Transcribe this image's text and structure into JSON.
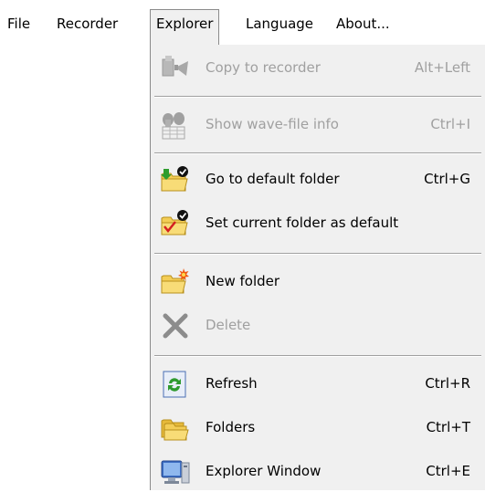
{
  "menubar": {
    "items": [
      {
        "label": "File"
      },
      {
        "label": "Recorder"
      },
      {
        "label": "Explorer"
      },
      {
        "label": "Language"
      },
      {
        "label": "About..."
      }
    ]
  },
  "explorer_menu": {
    "items": [
      {
        "label": "Copy to recorder",
        "shortcut": "Alt+Left",
        "enabled": false,
        "icon": "copy-to-recorder-icon"
      },
      {
        "label": "Show wave-file info",
        "shortcut": "Ctrl+I",
        "enabled": false,
        "icon": "wave-info-icon"
      },
      {
        "label": "Go to default folder",
        "shortcut": "Ctrl+G",
        "enabled": true,
        "icon": "default-folder-icon"
      },
      {
        "label": "Set current folder as default",
        "shortcut": "",
        "enabled": true,
        "icon": "set-default-folder-icon"
      },
      {
        "label": "New folder",
        "shortcut": "",
        "enabled": true,
        "icon": "new-folder-icon"
      },
      {
        "label": "Delete",
        "shortcut": "",
        "enabled": false,
        "icon": "delete-icon"
      },
      {
        "label": "Refresh",
        "shortcut": "Ctrl+R",
        "enabled": true,
        "icon": "refresh-icon"
      },
      {
        "label": "Folders",
        "shortcut": "Ctrl+T",
        "enabled": true,
        "icon": "folders-icon"
      },
      {
        "label": "Explorer Window",
        "shortcut": "Ctrl+E",
        "enabled": true,
        "icon": "explorer-window-icon"
      }
    ]
  },
  "colors": {
    "menu_bg": "#f0f0f0",
    "disabled_text": "#a0a0a0",
    "folder_yellow": "#f3cd55",
    "separator": "#a0a0a0"
  }
}
